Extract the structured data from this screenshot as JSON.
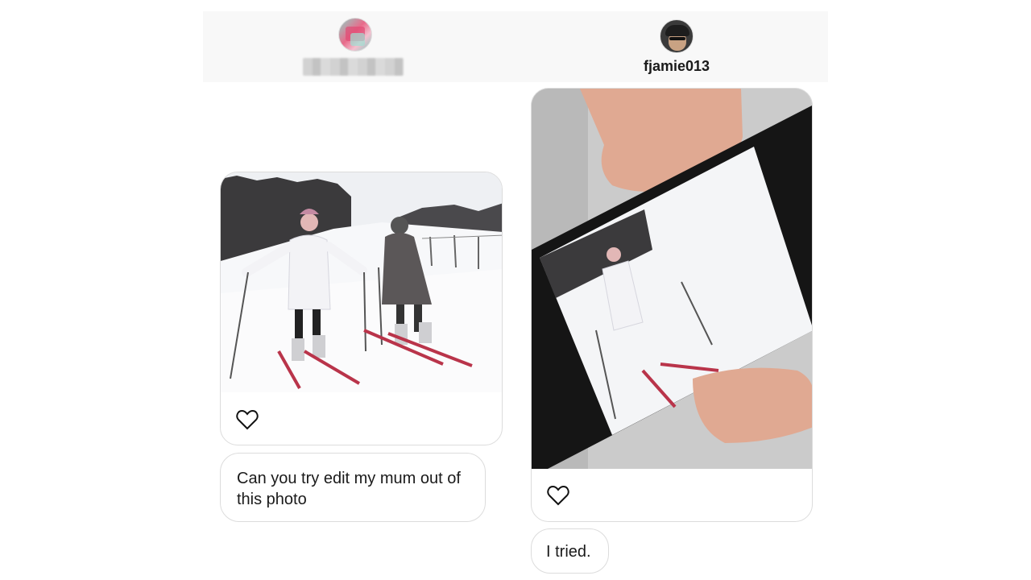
{
  "header": {
    "left_user": {
      "avatar_icon": "user-avatar-icon",
      "name_blurred": true
    },
    "right_user": {
      "avatar_icon": "user-avatar-icon",
      "username": "fjamie013"
    }
  },
  "messages": [
    {
      "sender": "left",
      "type": "photo",
      "photo_icon": "ski-photo",
      "like_icon": "heart-outline-icon"
    },
    {
      "sender": "left",
      "type": "text",
      "text": "Can you try edit my mum out of this photo"
    },
    {
      "sender": "right",
      "type": "photo",
      "photo_icon": "phone-photo",
      "like_icon": "heart-outline-icon"
    },
    {
      "sender": "right",
      "type": "text",
      "text": "I tried."
    }
  ],
  "colors": {
    "background": "#ffffff",
    "header": "#f8f8f8",
    "border": "#dcdcdc",
    "text": "#1a1a1a"
  }
}
